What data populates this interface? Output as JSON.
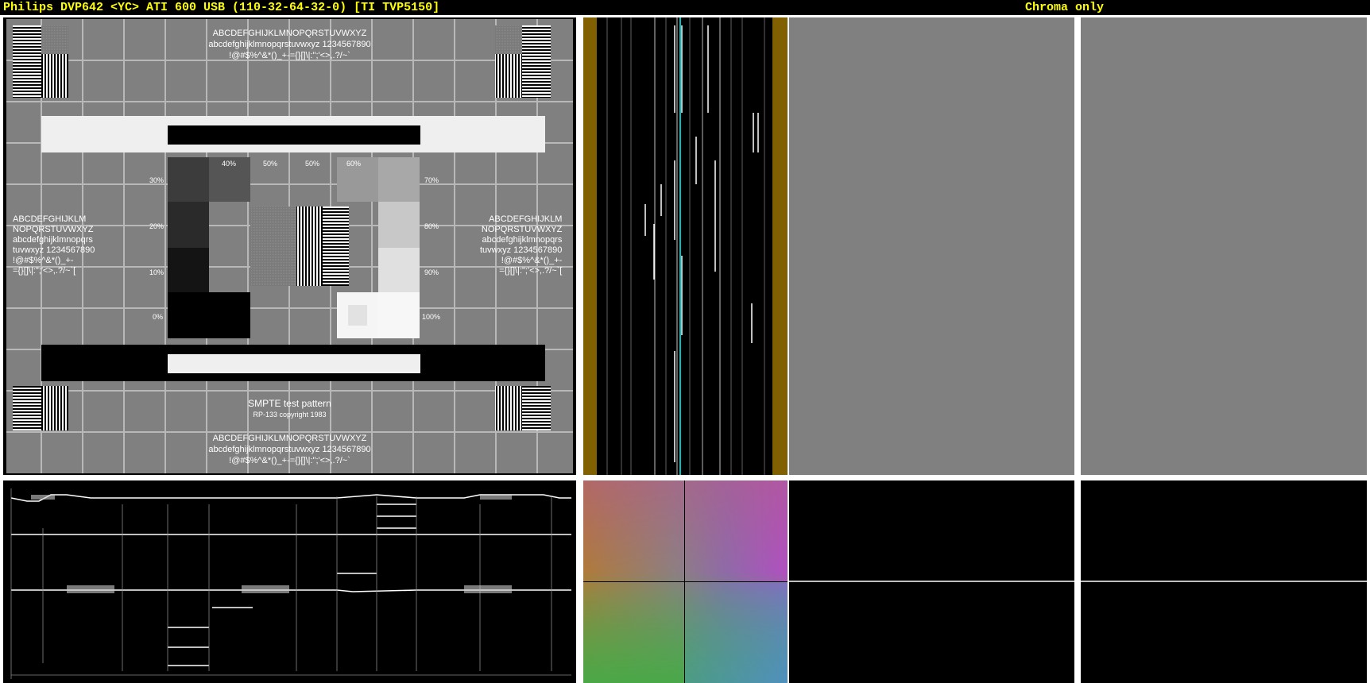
{
  "titlebar": {
    "device_title": "Philips DVP642 <YC> ATI 600 USB (110-32-64-32-0) [TI TVP5150]",
    "mode_label": "Chroma only"
  },
  "test_pattern": {
    "charset_line1": "ABCDEFGHIJKLMNOPQRSTUVWXYZ",
    "charset_line2": "abcdefghijklmnopqrstuvwxyz 1234567890",
    "charset_line3": "!@#$%^&*()_+-={}[]\\|:\";'<>,.?/~`",
    "side_left": "ABCDEFGHIJKLM\nNOPQRSTUVWXYZ\nabcdefghijklmnopqrs\ntuvwxyz 1234567890\n!@#$%^&*()_+-\n={}[]\\|:\";'<>,.?/~`[",
    "side_right": "ABCDEFGHIJKLM\nNOPQRSTUVWXYZ\nabcdefghijklmnopqrs\ntuvwxyz 1234567890\n!@#$%^&*()_+-\n={}[]\\|:\";'<>,.?/~`[",
    "pattern_name": "SMPTE test pattern",
    "copyright": "RP-133 copyright 1983",
    "percent_labels": {
      "p0": "0%",
      "p10": "10%",
      "p20": "20%",
      "p30": "30%",
      "p40": "40%",
      "p50a": "50%",
      "p50b": "50%",
      "p60": "60%",
      "p70": "70%",
      "p80": "80%",
      "p90": "90%",
      "p100": "100%"
    }
  },
  "colors": {
    "title_text": "#ffff00",
    "pattern_gray": "#808080",
    "waveform_border": "#806000",
    "vector_cyan": "#00c0c0"
  }
}
